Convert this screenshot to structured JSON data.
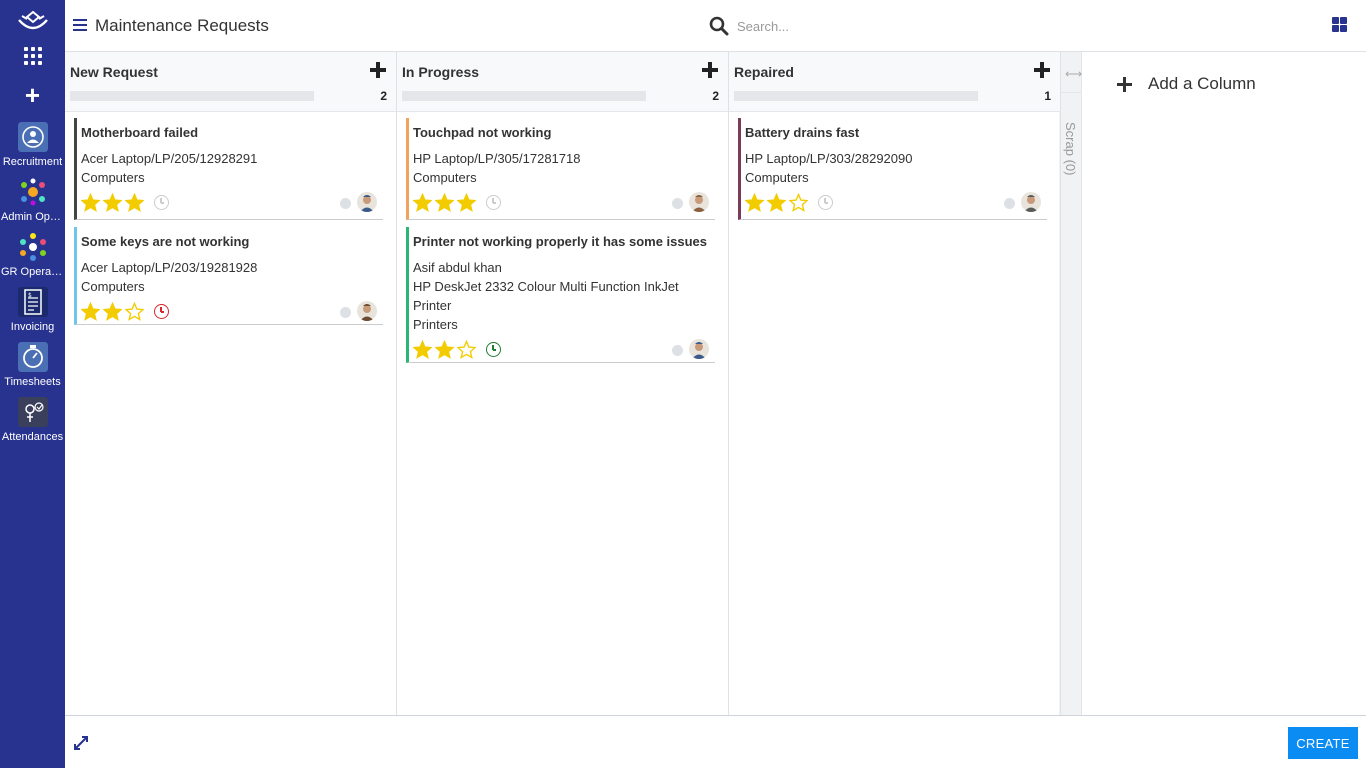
{
  "app": {
    "title": "Maintenance Requests",
    "search_placeholder": "Search...",
    "create_label": "CREATE",
    "add_column_label": "Add a Column",
    "folded_column_label": "Scrap (0)"
  },
  "sidebar": {
    "items": [
      {
        "label": "Recruitment",
        "icon": "recruitment-icon"
      },
      {
        "label": "Admin Oper...",
        "icon": "admin-operations-icon"
      },
      {
        "label": "GR Operatio...",
        "icon": "gr-operations-icon"
      },
      {
        "label": "Invoicing",
        "icon": "invoicing-icon"
      },
      {
        "label": "Timesheets",
        "icon": "timesheets-icon"
      },
      {
        "label": "Attendances",
        "icon": "attendances-icon"
      }
    ]
  },
  "columns": [
    {
      "title": "New Request",
      "count": "2",
      "cards": [
        {
          "title": "Motherboard failed",
          "lines": [
            "Acer Laptop/LP/205/12928291",
            "Computers"
          ],
          "stars": 3,
          "clock": "grey",
          "color": "#444444"
        },
        {
          "title": "Some keys are not working",
          "lines": [
            "Acer Laptop/LP/203/19281928",
            "Computers"
          ],
          "stars": 2,
          "clock": "red",
          "color": "#6ec6e8"
        }
      ]
    },
    {
      "title": "In Progress",
      "count": "2",
      "cards": [
        {
          "title": "Touchpad not working",
          "lines": [
            "HP Laptop/LP/305/17281718",
            "Computers"
          ],
          "stars": 3,
          "clock": "grey",
          "color": "#f0a35e"
        },
        {
          "title": "Printer not working properly it has some issues",
          "lines": [
            "Asif abdul khan",
            "HP DeskJet 2332 Colour Multi Function InkJet",
            "Printer",
            "Printers"
          ],
          "stars": 2,
          "clock": "green",
          "color": "#2bb673"
        }
      ]
    },
    {
      "title": "Repaired",
      "count": "1",
      "cards": [
        {
          "title": "Battery drains fast",
          "lines": [
            "HP Laptop/LP/303/28292090",
            "Computers"
          ],
          "stars": 2,
          "clock": "grey",
          "color": "#7c3a5a"
        }
      ]
    }
  ]
}
